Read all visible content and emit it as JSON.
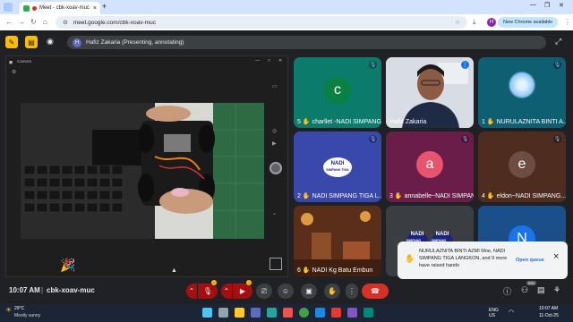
{
  "browser": {
    "tab_title": "Meet - cbk-xoav-muc",
    "tab_close": "×",
    "new_tab": "+",
    "url": "meet.google.com/cbk-xoav-muc",
    "update_btn": "New Chrome available",
    "profile_initial": "H"
  },
  "presenter": {
    "initial": "H",
    "text": "Hafiz Zakaria (Presenting, annotating)"
  },
  "stage": {
    "camera_title": "Camera"
  },
  "tiles": [
    {
      "initial": "c",
      "color": "#0b8043",
      "bg": "#0b7b6c",
      "label": "5",
      "name": "charllet -NADI SIMPANG..."
    },
    {
      "initial": "",
      "color": "",
      "bg": "#cfd8dc",
      "label": "",
      "name": "Hafiz Zakaria"
    },
    {
      "initial": "",
      "color": "",
      "bg": "#0f5f73",
      "label": "1",
      "name": "NURULAZNITA BINTI A..."
    },
    {
      "initial": "",
      "color": "",
      "bg": "#3949ab",
      "label": "2",
      "name": "NADI SIMPANG TIGA L..."
    },
    {
      "initial": "a",
      "color": "#e8546f",
      "bg": "#6b1d4a",
      "label": "3",
      "name": "annabelle~NADI SIMPANG..."
    },
    {
      "initial": "e",
      "color": "#6d4c41",
      "bg": "#4e2d20",
      "label": "4",
      "name": "eldon~NADI SIMPANG..."
    },
    {
      "initial": "",
      "color": "",
      "bg": "#6b3a1e",
      "label": "6",
      "name": "NADI Kg Batu Embun"
    },
    {
      "initial": "",
      "color": "",
      "bg": "#3a3d42",
      "label": "",
      "name": ""
    },
    {
      "initial": "N",
      "color": "#1a73e8",
      "bg": "#1b4f8a",
      "label": "",
      "name": ""
    }
  ],
  "nadi_logo": {
    "line1": "NADI",
    "line2": "SIMPANG TIGA"
  },
  "toast": {
    "text": "NURULAZNITA BINTI AZMI Moe, NADI SIMPANG TIGA LANGKON, and 9 more have raised hands",
    "action": "Open queue",
    "close": "×"
  },
  "controls": {
    "time": "10:07 AM",
    "separator": "|",
    "meeting_code": "cbk-xoav-muc",
    "participants_count": "696"
  },
  "taskbar": {
    "weather_temp": "29°C",
    "weather_text": "Mostly sunny",
    "lang": "ENG US",
    "clock_time": "10:07 AM",
    "clock_date": "11-Oct-25"
  },
  "colors": {
    "accent_yellow": "#fbbc04",
    "hangup_red": "#d93025",
    "link_blue": "#1a73e8"
  }
}
